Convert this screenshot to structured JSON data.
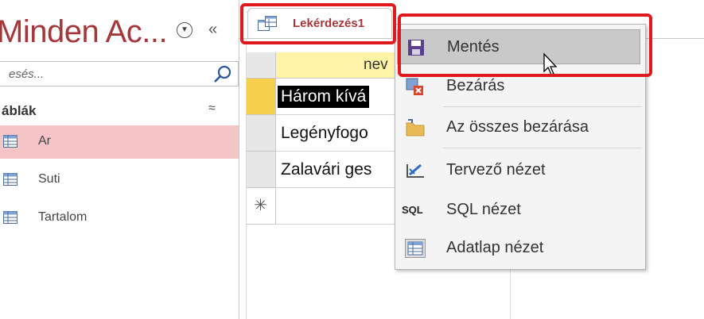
{
  "nav": {
    "title": "Minden Ac...",
    "search_placeholder": "esés...",
    "group_label": "áblák",
    "items": [
      {
        "label": "Ar",
        "selected": true
      },
      {
        "label": "Suti",
        "selected": false
      },
      {
        "label": "Tartalom",
        "selected": false
      }
    ]
  },
  "tab": {
    "label": "Lekérdezés1"
  },
  "datasheet": {
    "column_header": "nev",
    "rows": [
      "Három kívá",
      "Legényfogo",
      "Zalavári ges"
    ],
    "new_row_marker": "✳"
  },
  "context_menu": {
    "items": [
      {
        "label": "Mentés",
        "icon": "save-icon",
        "highlighted": true
      },
      {
        "label": "Bezárás",
        "icon": "close-document-icon"
      },
      {
        "label": "Az összes bezárása",
        "icon": "folder-icon"
      },
      {
        "label": "Tervező nézet",
        "icon": "design-view-icon"
      },
      {
        "label": "SQL nézet",
        "icon": "sql-icon"
      },
      {
        "label": "Adatlap nézet",
        "icon": "datasheet-view-icon"
      }
    ],
    "sql_icon_text": "SQL"
  },
  "colors": {
    "access_accent": "#a4373a",
    "selection_pink": "#f5c4c6",
    "annotation_red": "#e0191e",
    "header_yellow": "#fff3a8"
  }
}
